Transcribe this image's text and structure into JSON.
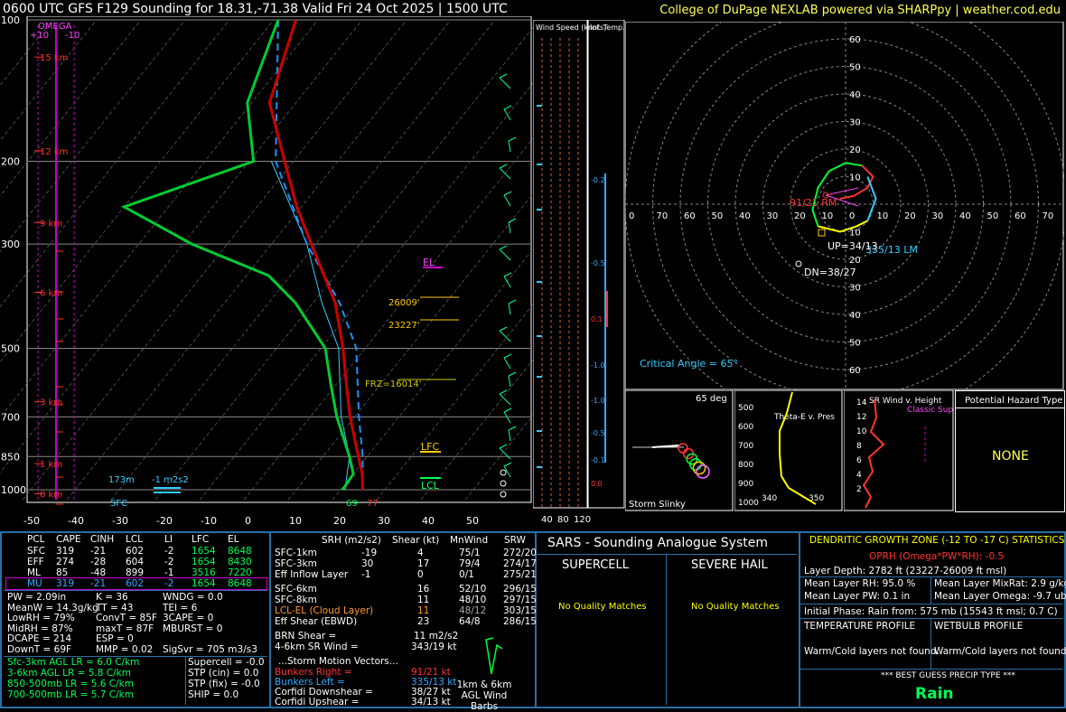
{
  "header": {
    "title": "0600 UTC GFS F129 Sounding for 18.31,-71.38 Valid  Fri 24 Oct 2025 | 1500 UTC",
    "credit": "College of DuPage NEXLAB powered via SHARPpy | weather.cod.edu"
  },
  "chart_data": [
    {
      "type": "line",
      "name": "skewt",
      "pressure_labels": [
        "100",
        "200",
        "300",
        "500",
        "700",
        "850",
        "1000"
      ],
      "pressure_levels": [
        100,
        200,
        300,
        500,
        700,
        850,
        1000
      ],
      "temp_ticks": [
        "-50",
        "-40",
        "-30",
        "-20",
        "-10",
        "0",
        "10",
        "20",
        "30",
        "40",
        "50"
      ],
      "temp_values": [
        -50,
        -40,
        -30,
        -20,
        -10,
        0,
        10,
        20,
        30,
        40,
        50
      ],
      "height_labels": [
        "15 km",
        "12 km",
        "9 km",
        "6 km",
        "3 km",
        "1 km",
        "0 km"
      ],
      "omega_labels": {
        "title": "OMEGA",
        "left": "+10",
        "right": "-10"
      },
      "annotations": {
        "el": "EL",
        "lfc": "LFC",
        "lcl": "LCL",
        "h26009": "26009'",
        "h23227": "23227'",
        "fzl": "FRZ=16014'",
        "surface_t": "77",
        "surface_td": "69",
        "sfc": "SFC",
        "eff_layer": "173m",
        "eff_srh": "-1 m2s2"
      },
      "temperature": [
        [
          100,
          -75
        ],
        [
          150,
          -66
        ],
        [
          200,
          -52
        ],
        [
          250,
          -41
        ],
        [
          300,
          -31
        ],
        [
          400,
          -15
        ],
        [
          500,
          -5
        ],
        [
          600,
          2.5
        ],
        [
          700,
          9
        ],
        [
          850,
          18
        ],
        [
          925,
          22
        ],
        [
          1000,
          25
        ]
      ],
      "dewpoint": [
        [
          100,
          -79
        ],
        [
          150,
          -71
        ],
        [
          200,
          -59
        ],
        [
          250,
          -80
        ],
        [
          300,
          -58
        ],
        [
          350,
          -35
        ],
        [
          400,
          -24
        ],
        [
          500,
          -9
        ],
        [
          600,
          -1
        ],
        [
          700,
          6
        ],
        [
          850,
          16
        ],
        [
          925,
          20
        ],
        [
          1000,
          20.5
        ]
      ],
      "parcel": [
        [
          100,
          -79
        ],
        [
          200,
          -54
        ],
        [
          300,
          -32
        ],
        [
          400,
          -14
        ],
        [
          500,
          -2
        ],
        [
          700,
          11
        ],
        [
          850,
          19
        ],
        [
          1000,
          25
        ]
      ],
      "wetbulb": [
        [
          200,
          -55
        ],
        [
          300,
          -32
        ],
        [
          400,
          -18
        ],
        [
          500,
          -6
        ],
        [
          700,
          7
        ],
        [
          850,
          16
        ],
        [
          1000,
          21
        ]
      ]
    },
    {
      "type": "line",
      "name": "hodograph",
      "ring_labels": [
        "10",
        "20",
        "30",
        "40",
        "50",
        "60"
      ],
      "x_labels": [
        "0",
        "70",
        "60",
        "50",
        "40",
        "30",
        "20",
        "10",
        "0",
        "10",
        "20",
        "30",
        "40",
        "50",
        "60",
        "70",
        "80"
      ],
      "points": [
        [
          -2,
          -2
        ],
        [
          3,
          -3
        ],
        [
          8,
          -6
        ],
        [
          10,
          -10
        ],
        [
          6,
          -14
        ],
        [
          0,
          -15
        ],
        [
          -6,
          -12
        ],
        [
          -10,
          -6
        ],
        [
          -12,
          2
        ],
        [
          -10,
          8
        ],
        [
          -2,
          10
        ],
        [
          4,
          8
        ],
        [
          8,
          6
        ],
        [
          11,
          -2
        ],
        [
          8,
          -10
        ]
      ],
      "labels": {
        "rm": "91/21 RM",
        "lm": "335/13 LM",
        "up": "UP=34/13",
        "dn": "DN=38/27",
        "critical": "Critical Angle = 65°"
      }
    }
  ],
  "wind_column": {
    "label1": "Wind Speed (knots)",
    "label2": "Inf. Temp. Adv.(C/ hr)",
    "ticks": [
      "40",
      "80",
      "120"
    ],
    "adv": [
      "-0.2",
      "-0.5",
      "0.1",
      "-1.0",
      "-1.0",
      "-0.5",
      "-0.1",
      "0.0"
    ]
  },
  "insets": {
    "slinky": {
      "title": "Storm Slinky",
      "deg": "65 deg"
    },
    "thetae": {
      "title": "Theta-E v. Pres",
      "p": [
        "500",
        "600",
        "700",
        "800",
        "900",
        "1000"
      ],
      "x": [
        "340",
        "350"
      ]
    },
    "srwind": {
      "title": "SR Wind v. Height",
      "label": "Classic Supercell",
      "h": [
        "14",
        "12",
        "10",
        "8",
        "6",
        "4",
        "2"
      ]
    },
    "hazard": {
      "title": "Potential Hazard Type",
      "value": "NONE"
    }
  },
  "parcels": {
    "head": [
      "PCL",
      "CAPE",
      "CINH",
      "LCL",
      "LI",
      "LFC",
      "EL"
    ],
    "rows": [
      [
        "SFC",
        "319",
        "-21",
        "602",
        "-2",
        "1654",
        "8648"
      ],
      [
        "EFF",
        "274",
        "-28",
        "604",
        "-2",
        "1654",
        "8430"
      ],
      [
        "ML",
        "85",
        "-48",
        "899",
        "-1",
        "3516",
        "7220"
      ],
      [
        "MU",
        "319",
        "-21",
        "602",
        "-2",
        "1654",
        "8648"
      ]
    ]
  },
  "indices": {
    "c1": [
      "PW = 2.09in",
      "MeanW = 14.3g/kg",
      "LowRH = 79%",
      "MidRH = 87%",
      "DCAPE = 214",
      "DownT = 69F"
    ],
    "c2": [
      "K = 36",
      "TT = 43",
      "ConvT = 85F",
      "maxT = 87F",
      "ESP = 0",
      "MMP = 0.02"
    ],
    "c3": [
      "WNDG = 0.0",
      "TEI = 6",
      "3CAPE = 0",
      "MBURST = 0",
      "",
      "SigSvr = 705 m3/s3"
    ]
  },
  "lapse": [
    "Sfc-3km AGL LR = 6.0 C/km",
    "3-6km AGL LR = 5.8 C/km",
    "850-500mb LR = 5.6 C/km",
    "700-500mb LR = 5.7 C/km"
  ],
  "composite": [
    "Supercell = -0.0",
    "STP (cin) = 0.0",
    "STP (fix) = -0.0",
    "SHIP = 0.0"
  ],
  "kinematics": {
    "head": [
      "SRH (m2/s2)",
      "Shear (kt)",
      "MnWind",
      "SRW"
    ],
    "rows": [
      [
        "SFC-1km",
        "-19",
        "4",
        "75/1",
        "272/20"
      ],
      [
        "SFC-3km",
        "30",
        "17",
        "79/4",
        "274/17"
      ],
      [
        "Eff Inflow Layer",
        "-1",
        "0",
        "0/1",
        "275/21"
      ],
      [
        "SFC-6km",
        "",
        "16",
        "52/10",
        "296/15"
      ],
      [
        "SFC-8km",
        "",
        "11",
        "48/10",
        "297/15"
      ],
      [
        "LCL-EL (Cloud Layer)",
        "",
        "11",
        "48/12",
        "303/15"
      ],
      [
        "Eff Shear (EBWD)",
        "",
        "23",
        "64/8",
        "286/15"
      ]
    ],
    "brn_shear": [
      "BRN Shear =",
      "11 m2/s2"
    ],
    "sr_wind": [
      "4-6km SR Wind =",
      "343/19 kt"
    ],
    "storm_title": "...Storm Motion Vectors...",
    "storm": [
      [
        "Bunkers Right =",
        "91/21 kt"
      ],
      [
        "Bunkers Left =",
        "335/13 kt"
      ],
      [
        "Corfidi Downshear =",
        "38/27 kt"
      ],
      [
        "Corfidi Upshear =",
        "34/13 kt"
      ]
    ],
    "barbs_label": "1km & 6km AGL Wind Barbs"
  },
  "sars": {
    "title": "SARS - Sounding Analogue System",
    "supercell": "SUPERCELL",
    "hail": "SEVERE HAIL",
    "sc_msg": "No Quality Matches",
    "hail_msg": "No Quality Matches"
  },
  "dgz": {
    "title": "DENDRITIC GROWTH ZONE (-12 TO -17 C) STATISTICS",
    "oprh": "OPRH (Omega*PW*RH): -0.5",
    "depth": "Layer Depth: 2782 ft (23227-26009 ft msl)",
    "rh": "Mean Layer RH: 95.0 %",
    "mixr": "Mean Layer MixRat: 2.9 g/kg",
    "pw": "Mean Layer PW: 0.1 in",
    "omega": "Mean Layer Omega: -9.7 ub/s",
    "phase": "Initial Phase: Rain from: 575 mb (15543 ft msl; 0.7 C)",
    "temp_title": "TEMPERATURE PROFILE",
    "wb_title": "WETBULB PROFILE",
    "temp_msg": "Warm/Cold layers not found.",
    "wb_msg": "Warm/Cold layers not found.",
    "precip_title": "*** BEST GUESS PRECIP TYPE ***",
    "precip": "Rain"
  }
}
